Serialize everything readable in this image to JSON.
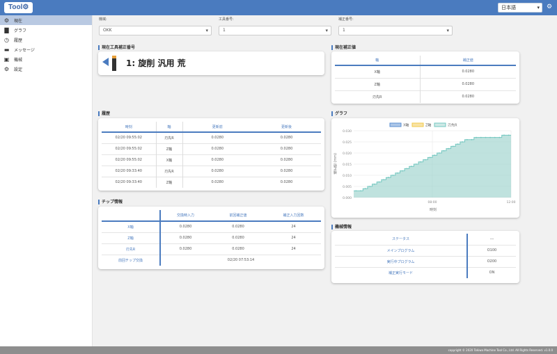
{
  "header": {
    "logo": "Tool⚙",
    "language": "日本語"
  },
  "sidebar": {
    "items": [
      {
        "icon": "⚙",
        "label": "現在",
        "active": true
      },
      {
        "icon": "▇",
        "label": "グラフ"
      },
      {
        "icon": "◷",
        "label": "履歴"
      },
      {
        "icon": "▬",
        "label": "メッセージ"
      },
      {
        "icon": "▣",
        "label": "機械"
      },
      {
        "icon": "⚙",
        "label": "設定"
      }
    ]
  },
  "filters": [
    {
      "label": "機械:",
      "value": "OKK"
    },
    {
      "label": "工具番号:",
      "value": "1"
    },
    {
      "label": "補正番号:",
      "value": "1"
    }
  ],
  "tool_panel": {
    "title": "現在工具補正番号",
    "tool_name": "1: 旋削 汎用 荒"
  },
  "offset_panel": {
    "title": "現在補正値",
    "columns": [
      "軸",
      "補正値"
    ],
    "rows": [
      [
        "X軸",
        "0.0280"
      ],
      [
        "Z軸",
        "0.0280"
      ],
      [
        "刃先R",
        "0.0280"
      ]
    ]
  },
  "history_panel": {
    "title": "履歴",
    "columns": [
      "時刻",
      "軸",
      "更新前",
      "更新後"
    ],
    "rows": [
      [
        "02/20 09:55:02",
        "刃先R",
        "0.0280",
        "0.0280"
      ],
      [
        "02/20 09:55:02",
        "Z軸",
        "0.0280",
        "0.0280"
      ],
      [
        "02/20 09:55:02",
        "X軸",
        "0.0280",
        "0.0280"
      ],
      [
        "02/20 09:33:40",
        "刃先R",
        "0.0280",
        "0.0280"
      ],
      [
        "02/20 09:33:40",
        "Z軸",
        "0.0280",
        "0.0280"
      ]
    ]
  },
  "chip_panel": {
    "title": "チップ情報",
    "columns": [
      "",
      "交換時入力",
      "前回補正値",
      "補正入力回数"
    ],
    "rows": [
      [
        "X軸",
        "0.0280",
        "0.0280",
        "24"
      ],
      [
        "Z軸",
        "0.0280",
        "0.0280",
        "24"
      ],
      [
        "刃先R",
        "0.0280",
        "0.0280",
        "24"
      ]
    ],
    "last_label": "前回チップ交換",
    "last_value": "02/20 07:53:14"
  },
  "machine_panel": {
    "title": "機械情報",
    "rows": [
      [
        "ステータス",
        "---"
      ],
      [
        "メインプログラム",
        "O100"
      ],
      [
        "実行中プログラム",
        "O200"
      ],
      [
        "補正実行モード",
        "ON"
      ]
    ]
  },
  "chart_data": {
    "type": "area",
    "title": "グラフ",
    "series": [
      {
        "name": "X軸",
        "color": "#5b8fd1",
        "fill": "#5b8fd1"
      },
      {
        "name": "Z軸",
        "color": "#f2c84b",
        "fill": "#f2c84b"
      },
      {
        "name": "刃先R",
        "color": "#73c7c0",
        "fill": "#9dd3cd",
        "values": [
          0.003,
          0.003,
          0.004,
          0.005,
          0.006,
          0.007,
          0.008,
          0.009,
          0.01,
          0.011,
          0.012,
          0.013,
          0.014,
          0.015,
          0.016,
          0.017,
          0.018,
          0.019,
          0.02,
          0.021,
          0.022,
          0.023,
          0.024,
          0.025,
          0.026,
          0.026,
          0.027,
          0.027,
          0.027,
          0.027,
          0.027,
          0.027,
          0.028,
          0.028
        ]
      }
    ],
    "ylim": [
      0,
      0.03
    ],
    "yticks": [
      "0.000",
      "0.005",
      "0.010",
      "0.015",
      "0.020",
      "0.025",
      "0.030"
    ],
    "xticks": [
      "08:00",
      "12:00"
    ],
    "xlabel": "時刻",
    "ylabel": "補正値 (mm)"
  },
  "footer": {
    "text": "copyright © 2020 Tokiwa Machine Tool Co., Ltd. All Rights Reserved. v1.0.0"
  }
}
